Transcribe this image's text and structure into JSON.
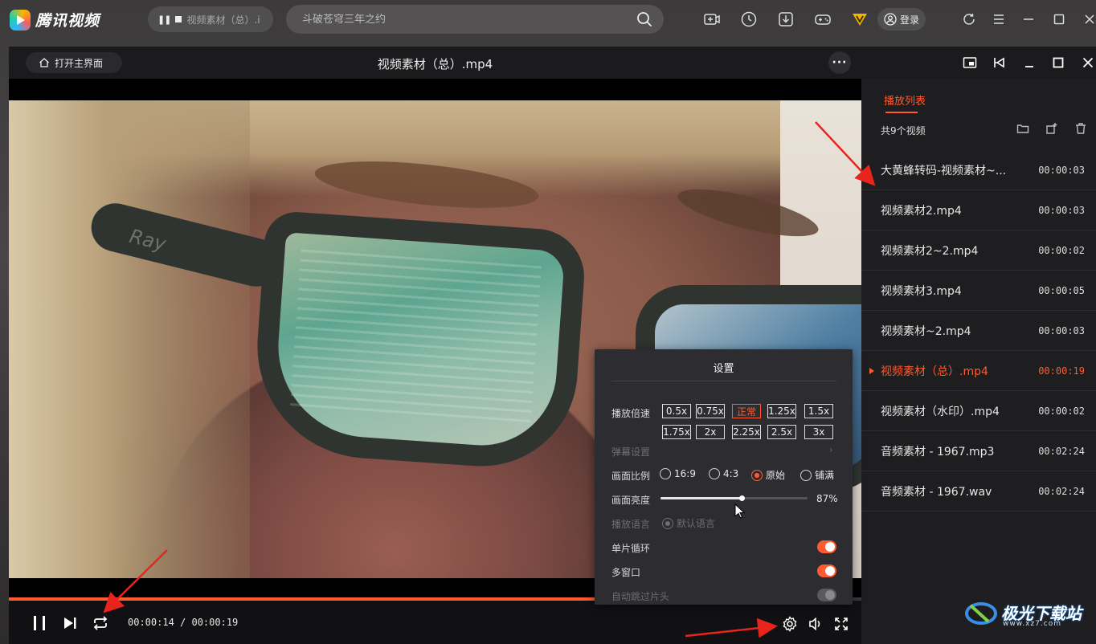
{
  "app": {
    "logo_text": "腾讯视频"
  },
  "topbar": {
    "mini_player_title": "视频素材（总）.i",
    "search_placeholder": "斗破苍穹三年之约",
    "login_label": "登录",
    "accent": "#ff5a30"
  },
  "player": {
    "home_label": "打开主界面",
    "title": "视频素材（总）.mp4",
    "current_time": "00:00:14",
    "total_time": "00:00:19",
    "time_separator": " / ",
    "progress": 0.737
  },
  "playlist": {
    "tab_label": "播放列表",
    "count_label": "共9个视频",
    "items": [
      {
        "name": "大黄蜂转码-视频素材~...",
        "duration": "00:00:03",
        "active": false
      },
      {
        "name": "视频素材2.mp4",
        "duration": "00:00:03",
        "active": false
      },
      {
        "name": "视频素材2~2.mp4",
        "duration": "00:00:02",
        "active": false
      },
      {
        "name": "视频素材3.mp4",
        "duration": "00:00:05",
        "active": false
      },
      {
        "name": "视频素材~2.mp4",
        "duration": "00:00:03",
        "active": false
      },
      {
        "name": "视频素材（总）.mp4",
        "duration": "00:00:19",
        "active": true
      },
      {
        "name": "视频素材（水印）.mp4",
        "duration": "00:00:02",
        "active": false
      },
      {
        "name": "音频素材 - 1967.mp3",
        "duration": "00:02:24",
        "active": false
      },
      {
        "name": "音频素材 - 1967.wav",
        "duration": "00:02:24",
        "active": false
      }
    ]
  },
  "settings": {
    "title": "设置",
    "speed_label": "播放倍速",
    "speeds": [
      "0.5x",
      "0.75x",
      "正常",
      "1.25x",
      "1.5x",
      "1.75x",
      "2x",
      "2.25x",
      "2.5x",
      "3x"
    ],
    "selected_speed": "正常",
    "danmaku_label": "弹幕设置",
    "ratio_label": "画面比例",
    "ratios": [
      "16:9",
      "4:3",
      "原始",
      "铺满"
    ],
    "selected_ratio": "原始",
    "brightness_label": "画面亮度",
    "brightness_value": "87%",
    "brightness": 0.55,
    "language_label": "播放语言",
    "language_option": "默认语言",
    "loop_label": "单片循环",
    "multiwindow_label": "多窗口",
    "skip_intro_label": "自动跳过片头"
  },
  "watermark": {
    "text": "极光下载站",
    "sub": "www.xz7.com"
  }
}
